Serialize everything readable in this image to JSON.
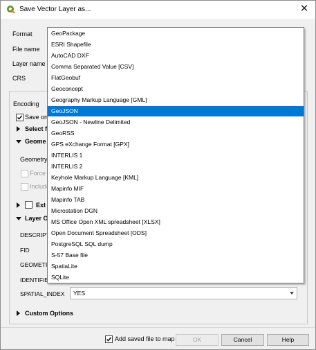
{
  "window": {
    "title": "Save Vector Layer as...",
    "close_glyph": "✕",
    "accent_color": "#0078d7"
  },
  "fields": {
    "format_label": "Format",
    "file_name_label": "File name",
    "layer_name_label": "Layer name",
    "crs_label": "CRS",
    "encoding_label": "Encoding"
  },
  "options": {
    "save_only_label": "Save onl",
    "select_fields_label": "Select f",
    "geometry_section_label": "Geome",
    "geometry_label": "Geometry",
    "force_label": "Force",
    "include_label": "Include",
    "extent_label": "Ext",
    "layer_options_label": "Layer O",
    "layer_opt_rows": [
      "DESCRIPT",
      "FID",
      "GEOMETRY",
      "IDENTIFIE"
    ],
    "spatial_index_label": "SPATIAL_INDEX",
    "spatial_index_value": "YES",
    "custom_options_label": "Custom Options"
  },
  "footer": {
    "add_saved_label": "Add saved file to map",
    "add_saved_checked": true,
    "ok_label": "OK",
    "cancel_label": "Cancel",
    "help_label": "Help"
  },
  "format_dropdown": {
    "selected": "GeoJSON",
    "items": [
      "GeoPackage",
      "ESRI Shapefile",
      "AutoCAD DXF",
      "Comma Separated Value [CSV]",
      "FlatGeobuf",
      "Geoconcept",
      "Geography Markup Language [GML]",
      "GeoJSON",
      "GeoJSON - Newline Delimited",
      "GeoRSS",
      "GPS eXchange Format [GPX]",
      "INTERLIS 1",
      "INTERLIS 2",
      "Keyhole Markup Language [KML]",
      "Mapinfo MIF",
      "Mapinfo TAB",
      "Microstation DGN",
      "MS Office Open XML spreadsheet [XLSX]",
      "Open Document Spreadsheet [ODS]",
      "PostgreSQL SQL dump",
      "S-57 Base file",
      "SpatiaLite",
      "SQLite"
    ]
  }
}
